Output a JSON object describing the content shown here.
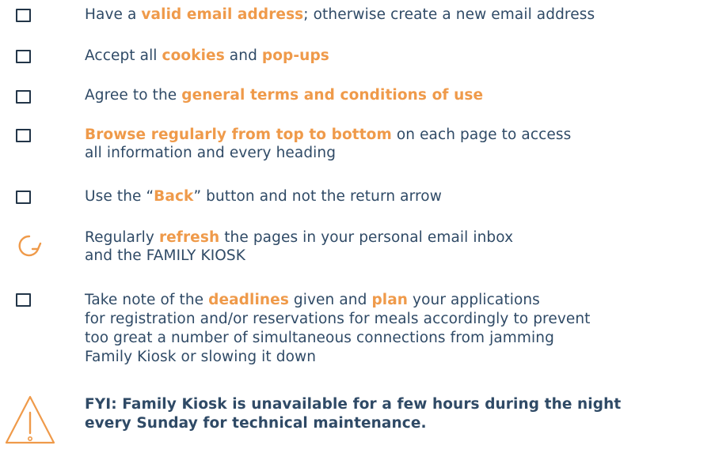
{
  "items": [
    {
      "icon": "checkbox-icon",
      "segments": [
        {
          "text": "Have a ",
          "highlight": false
        },
        {
          "text": "valid email address",
          "highlight": true
        },
        {
          "text": "; otherwise create a new email address",
          "highlight": false
        }
      ]
    },
    {
      "icon": "checkbox-icon",
      "segments": [
        {
          "text": "Accept all ",
          "highlight": false
        },
        {
          "text": "cookies",
          "highlight": true
        },
        {
          "text": " and ",
          "highlight": false
        },
        {
          "text": "pop-ups",
          "highlight": true
        }
      ]
    },
    {
      "icon": "checkbox-icon",
      "segments": [
        {
          "text": "Agree to the ",
          "highlight": false
        },
        {
          "text": "general terms and conditions of use",
          "highlight": true
        }
      ]
    },
    {
      "icon": "checkbox-icon",
      "lines": [
        [
          {
            "text": "Browse regularly from top to bottom",
            "highlight": true
          },
          {
            "text": " on each page to access",
            "highlight": false
          }
        ],
        [
          {
            "text": "all information and every heading",
            "highlight": false
          }
        ]
      ]
    },
    {
      "icon": "checkbox-icon",
      "segments": [
        {
          "text": "Use the “",
          "highlight": false
        },
        {
          "text": "Back",
          "highlight": true
        },
        {
          "text": "” button and not the return arrow",
          "highlight": false
        }
      ]
    },
    {
      "icon": "refresh-icon",
      "lines": [
        [
          {
            "text": "Regularly ",
            "highlight": false
          },
          {
            "text": "refresh",
            "highlight": true
          },
          {
            "text": " the pages in your personal email inbox",
            "highlight": false
          }
        ],
        [
          {
            "text": "and the FAMILY KIOSK",
            "highlight": false
          }
        ]
      ]
    },
    {
      "icon": "checkbox-icon",
      "lines": [
        [
          {
            "text": "Take note of the ",
            "highlight": false
          },
          {
            "text": "deadlines",
            "highlight": true
          },
          {
            "text": " given and ",
            "highlight": false
          },
          {
            "text": "plan",
            "highlight": true
          },
          {
            "text": " your applications",
            "highlight": false
          }
        ],
        [
          {
            "text": "for registration and/or reservations for meals accordingly to prevent",
            "highlight": false
          }
        ],
        [
          {
            "text": "too great a number of simultaneous connections from jamming",
            "highlight": false
          }
        ],
        [
          {
            "text": "Family Kiosk or slowing it down",
            "highlight": false
          }
        ]
      ]
    }
  ],
  "warning": {
    "icon": "warning-icon",
    "line1": "FYI: Family Kiosk is unavailable for a few hours during the night",
    "line2": "every Sunday for technical maintenance."
  },
  "colors": {
    "text": "#2f4a66",
    "highlight": "#ef9a4a",
    "icon_dark": "#223548",
    "icon_orange": "#ef9a4a"
  }
}
